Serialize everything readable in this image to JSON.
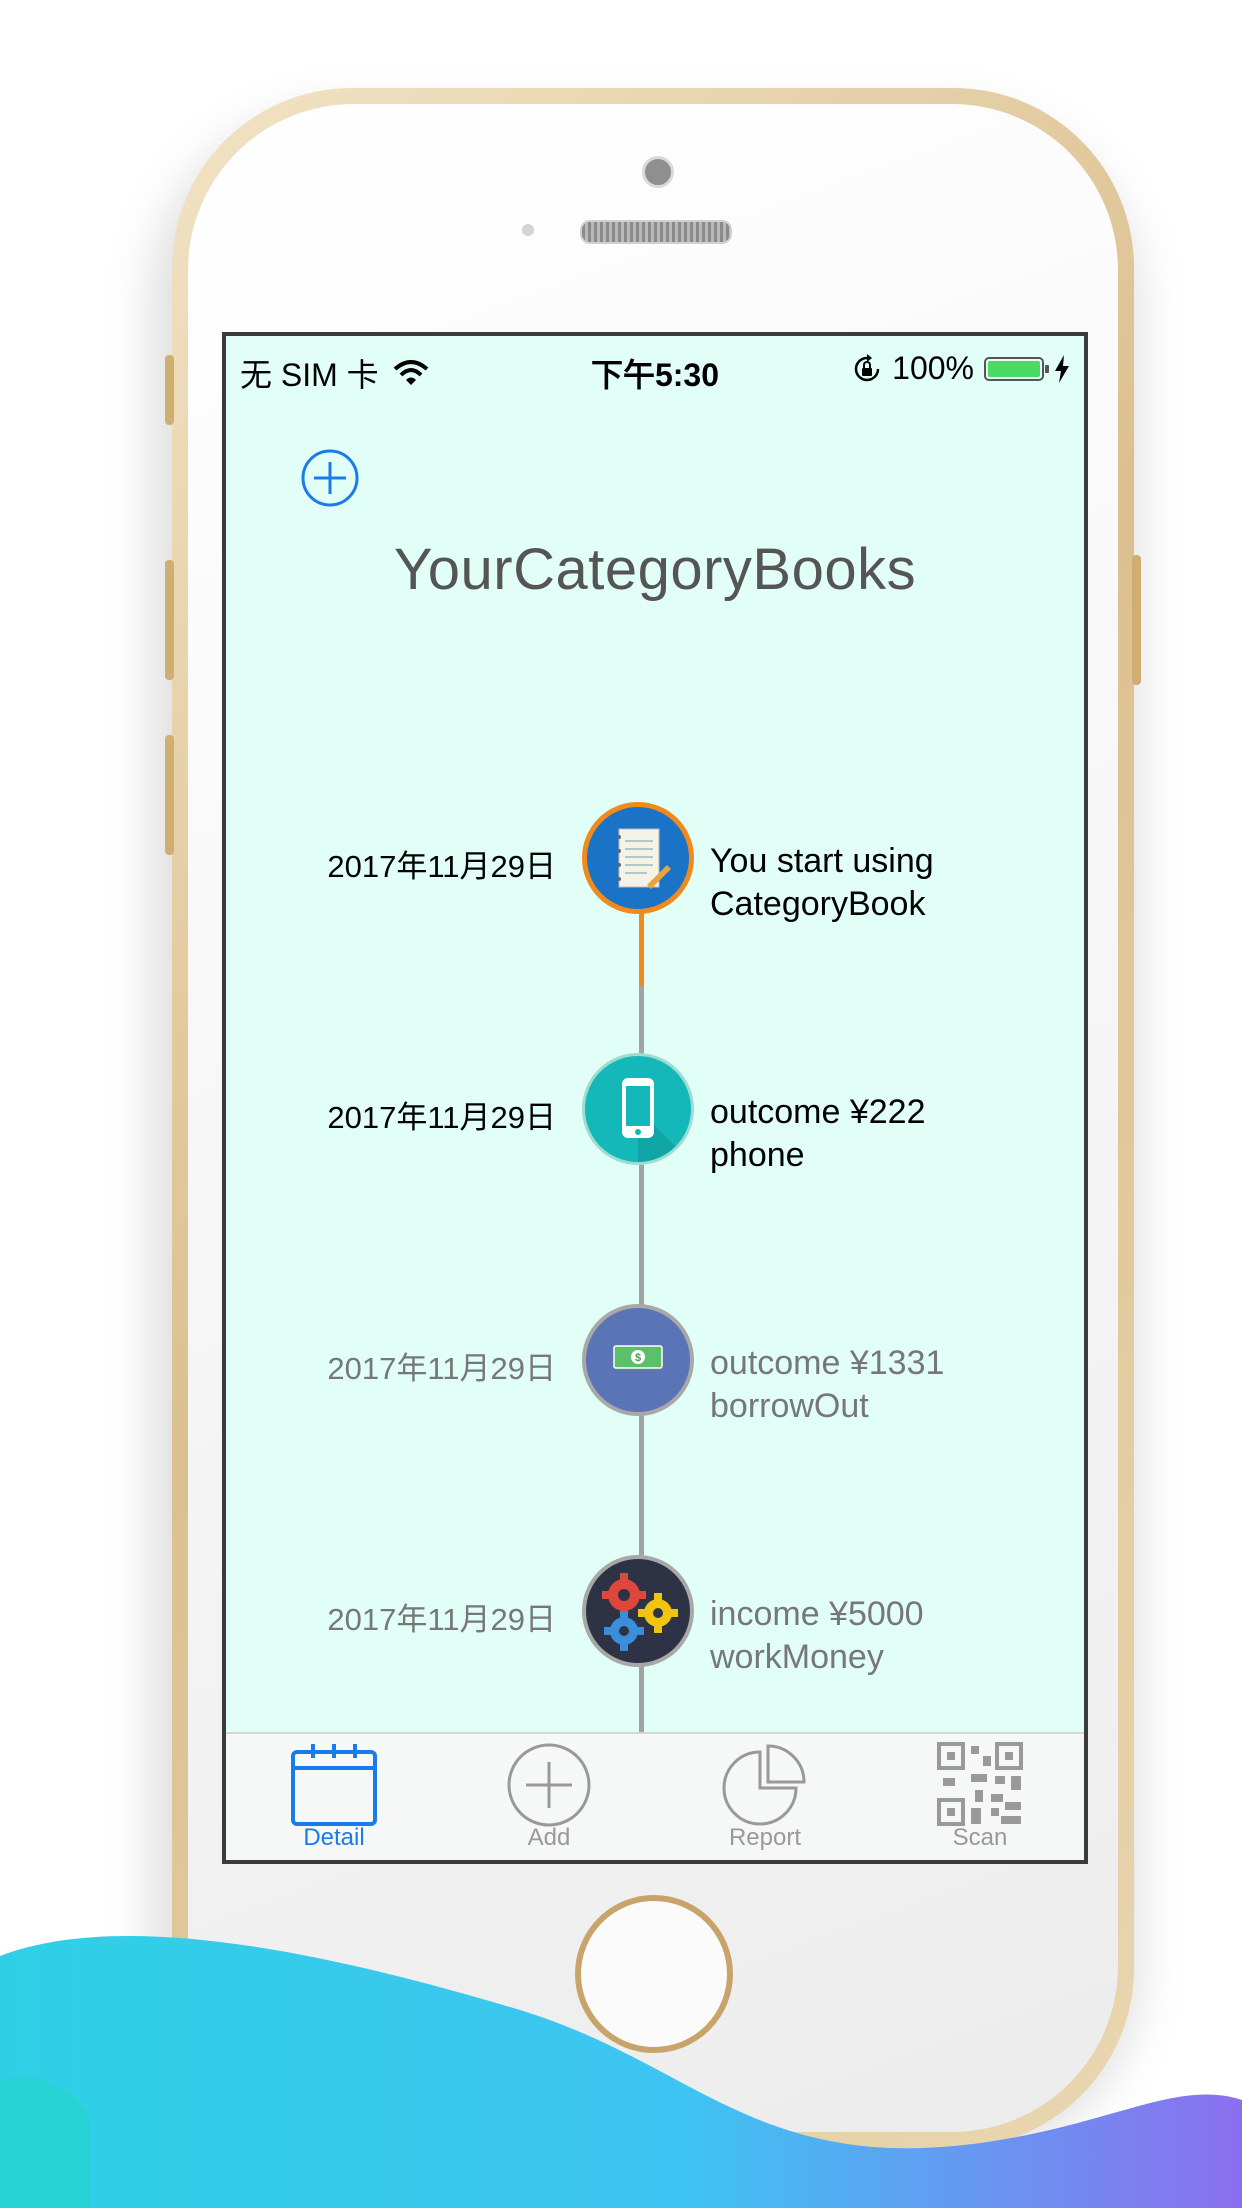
{
  "status_bar": {
    "carrier": "无 SIM 卡",
    "time": "下午5:30",
    "battery": "100%"
  },
  "header": {
    "title": "YourCategoryBooks"
  },
  "timeline": [
    {
      "date": "2017年11月29日",
      "line1": "You start using",
      "line2": "CategoryBook",
      "icon": "notebook-icon",
      "faded": false
    },
    {
      "date": "2017年11月29日",
      "line1": "outcome ¥222",
      "line2": "phone",
      "icon": "phone-icon",
      "faded": false
    },
    {
      "date": "2017年11月29日",
      "line1": "outcome ¥1331",
      "line2": "borrowOut",
      "icon": "cash-icon",
      "faded": true
    },
    {
      "date": "2017年11月29日",
      "line1": "income ¥5000",
      "line2": "workMoney",
      "icon": "gears-icon",
      "faded": true
    }
  ],
  "tabs": [
    {
      "label": "Detail",
      "icon": "calendar-icon",
      "active": true
    },
    {
      "label": "Add",
      "icon": "plus-circle-icon",
      "active": false
    },
    {
      "label": "Report",
      "icon": "pie-chart-icon",
      "active": false
    },
    {
      "label": "Scan",
      "icon": "qr-code-icon",
      "active": false
    }
  ],
  "colors": {
    "screen_background": "#e1fff7",
    "accent_blue": "#1a7bea",
    "timeline_active": "#f08a1c",
    "timeline_inactive": "#a3a3a3",
    "wave_start": "#2fd0e6",
    "wave_end": "#8b6ff0"
  }
}
